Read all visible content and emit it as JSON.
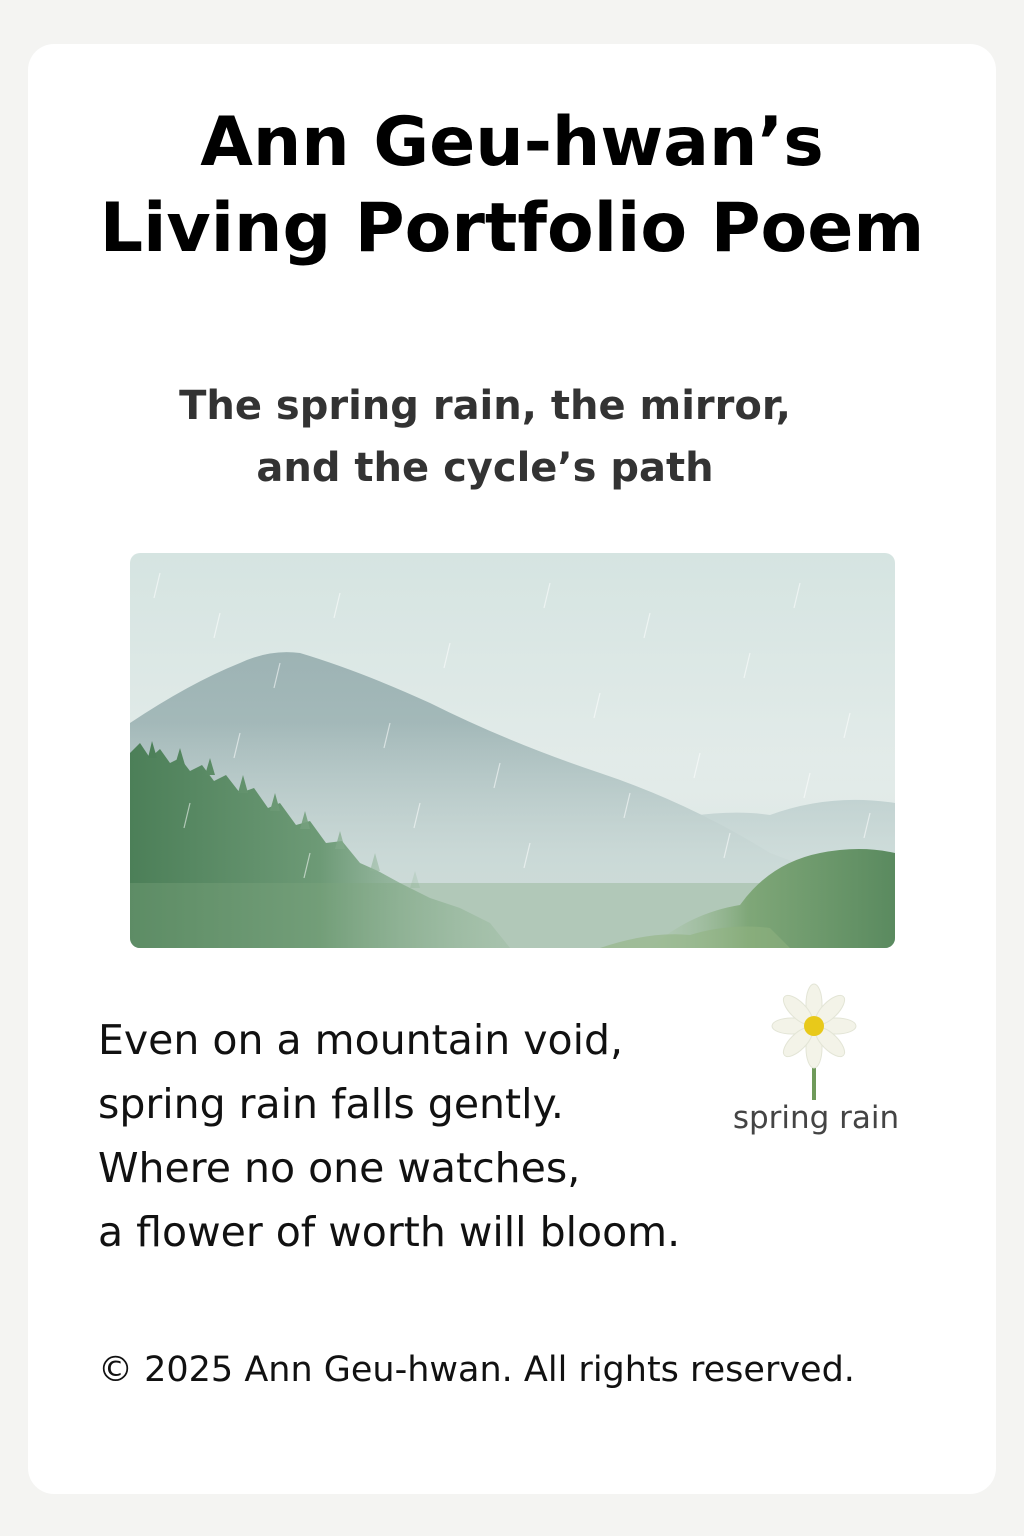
{
  "title": {
    "line1": "Ann Geu-hwan’s",
    "line2": "Living Portfolio Poem"
  },
  "subtitle": {
    "line1": "The spring rain, the mirror,",
    "line2": "and the cycle’s path"
  },
  "illustration": {
    "icon": "misty-rain-mountain-icon"
  },
  "poem": {
    "lines": [
      "Even on a mountain void,",
      "spring rain falls gently.",
      "Where no one watches,",
      "a flower of worth will bloom."
    ]
  },
  "flower": {
    "icon": "daisy-flower-icon",
    "caption": "spring rain"
  },
  "footer": {
    "copyright": "© 2025 Ann Geu-hwan. All rights reserved."
  },
  "colors": {
    "background": "#f4f4f2",
    "card": "#ffffff",
    "text": "#111111",
    "forest": "#4f7f5a",
    "mist": "#cfdedd",
    "flower_center": "#e8c91a"
  }
}
